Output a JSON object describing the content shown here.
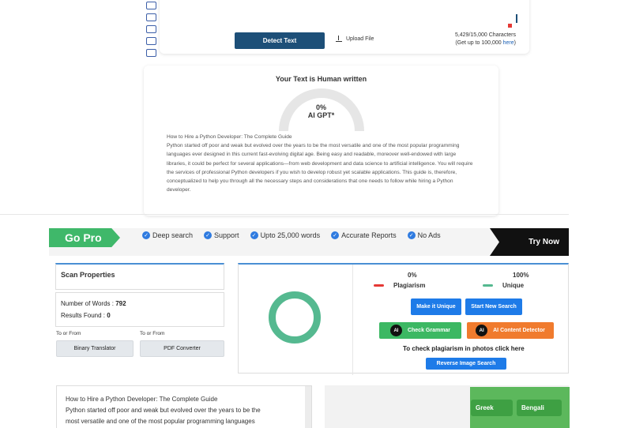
{
  "top": {
    "detect_label": "Detect Text",
    "upload_label": "Upload File",
    "char_count": "5,429/15,000 Characters",
    "char_upgrade_prefix": "(Get up to 100,000 ",
    "char_upgrade_link": "here",
    "char_upgrade_suffix": ")"
  },
  "result": {
    "title": "Your Text is Human written",
    "percent": "0%",
    "label": "AI GPT*",
    "text_title": "How to Hire a Python Developer: The Complete Guide",
    "text_body": "Python started off poor and weak but evolved over the years to be the most versatile and one of the most popular programming languages ever designed in this current fast-evolving digital age. Being easy and readable, moreover well-endowed with large libraries, it could be perfect for several applications—from web development and data science to artificial intelligence. You will require the services of professional Python developers if you wish to develop robust yet scalable applications. This guide is, therefore, conceptualized to help you through all the necessary steps and considerations that one needs to follow while hiring a Python developer."
  },
  "gopro": {
    "title": "Go Pro",
    "features": [
      "Deep search",
      "Support",
      "Upto 25,000 words",
      "Accurate Reports",
      "No Ads"
    ],
    "cta": "Try Now"
  },
  "scan": {
    "title": "Scan Properties",
    "words_label": "Number of Words : ",
    "words_value": "792",
    "results_label": "Results Found : ",
    "results_value": "0",
    "to_from_1": "To or From",
    "to_from_2": "To or From",
    "binary_btn": "Binary Translator",
    "pdf_btn": "PDF Converter"
  },
  "plag": {
    "plag_pct": "0%",
    "plag_label": "Plagiarism",
    "unique_pct": "100%",
    "unique_label": "Unique",
    "unique_fraction": 1.0,
    "make_unique": "Make it Unique",
    "start_search": "Start New Search",
    "check_grammar": "Check Grammar",
    "ai_detector": "AI Content Detector",
    "photo_text": "To check plagiarism in photos click here",
    "reverse_search": "Reverse Image Search",
    "colors": {
      "plagiarism": "#e53935",
      "unique": "#55b990"
    }
  },
  "bottom": {
    "title": "How to Hire a Python Developer: The Complete Guide",
    "line1": "Python started off poor and weak but evolved over the years to be the",
    "line2": "most versatile and one of the most popular programming languages",
    "languages": [
      "Greek",
      "Bengali"
    ]
  }
}
